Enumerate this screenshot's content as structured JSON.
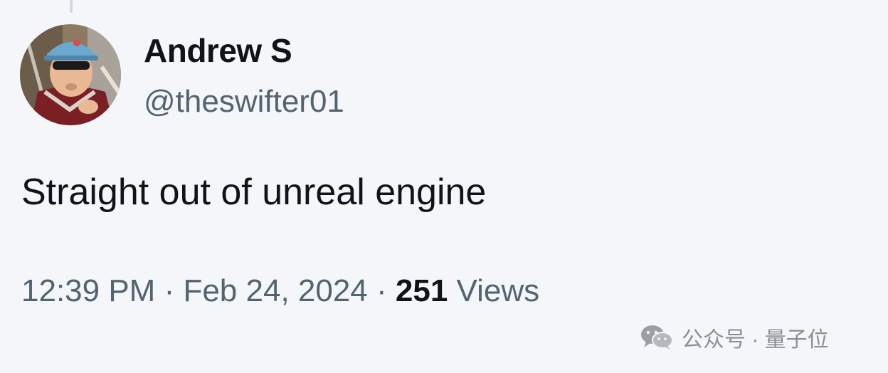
{
  "tweet": {
    "author": {
      "display_name": "Andrew S",
      "handle": "@theswifter01",
      "avatar_icon": "avatar-photo"
    },
    "text": "Straight out of unreal engine",
    "timestamp": {
      "time": "12:39 PM",
      "separator_1": " · ",
      "date": "Feb 24, 2024",
      "separator_2": " · ",
      "views_count": "251",
      "views_label": " Views"
    }
  },
  "watermark": {
    "icon": "wechat-icon",
    "text": "公众号 · 量子位"
  },
  "colors": {
    "background": "#f5f6f9",
    "primary_text": "#0f1419",
    "secondary_text": "#536471",
    "watermark_text": "#8a8f96"
  }
}
